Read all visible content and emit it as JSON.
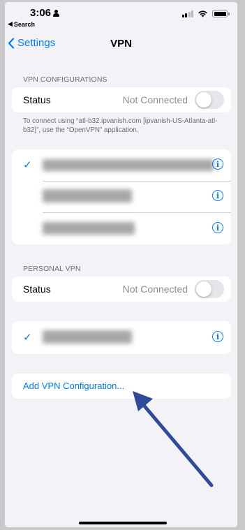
{
  "status_bar": {
    "time": "3:06",
    "back_app_label": "Search",
    "signal_bars_filled": 2,
    "signal_bars_total": 4
  },
  "nav": {
    "back_label": "Settings",
    "title": "VPN"
  },
  "vpn_configurations": {
    "header": "VPN CONFIGURATIONS",
    "status_label": "Status",
    "status_value": "Not Connected",
    "toggle_on": false,
    "footnote": "To connect using “atl-b32.ipvanish.com [ipvanish-US-Atlanta-atl-b32]”, use the “OpenVPN” application.",
    "configs": [
      {
        "selected": true,
        "name_obscured": true
      },
      {
        "selected": false,
        "name_obscured": true
      },
      {
        "selected": false,
        "name_obscured": true
      }
    ]
  },
  "personal_vpn": {
    "header": "PERSONAL VPN",
    "status_label": "Status",
    "status_value": "Not Connected",
    "toggle_on": false,
    "configs": [
      {
        "selected": true,
        "name_obscured": true
      }
    ]
  },
  "add_configuration_label": "Add VPN Configuration...",
  "icons": {
    "checkmark": "✓",
    "info": "i",
    "back": "‹"
  },
  "colors": {
    "accent": "#007aff",
    "background": "#f2f2f7",
    "annotation_arrow": "#2f4a9a"
  }
}
